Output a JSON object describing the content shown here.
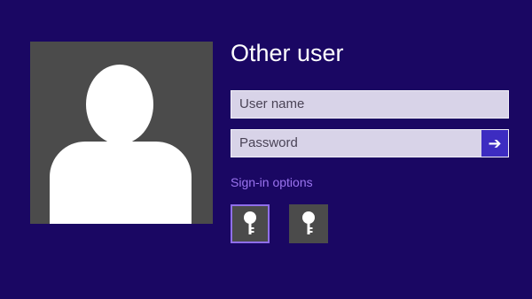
{
  "login": {
    "title": "Other user",
    "username_placeholder": "User name",
    "password_placeholder": "Password",
    "submit_icon": "arrow-right-icon",
    "signin_options_label": "Sign-in options"
  },
  "signin_options": [
    {
      "icon": "key-icon",
      "selected": true
    },
    {
      "icon": "key-icon",
      "selected": false
    }
  ],
  "colors": {
    "background": "#1a0763",
    "avatar_bg": "#4b4b4b",
    "field_bg": "#d8d3e8",
    "accent": "#3d2cc1",
    "link": "#9b74f0"
  }
}
